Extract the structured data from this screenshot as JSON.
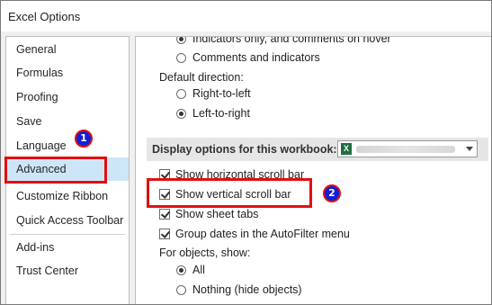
{
  "window": {
    "title": "Excel Options"
  },
  "sidebar": {
    "items": [
      {
        "label": "General"
      },
      {
        "label": "Formulas"
      },
      {
        "label": "Proofing"
      },
      {
        "label": "Save"
      },
      {
        "label": "Language"
      },
      {
        "label": "Advanced",
        "selected": true
      },
      {
        "label": "Customize Ribbon"
      },
      {
        "label": "Quick Access Toolbar"
      },
      {
        "label": "Add-ins"
      },
      {
        "label": "Trust Center"
      }
    ]
  },
  "content": {
    "comments": {
      "indicators_only": "Indicators only, and comments on hover",
      "comments_and_indicators": "Comments and indicators"
    },
    "default_direction": {
      "label": "Default direction:",
      "right_to_left": "Right-to-left",
      "left_to_right": "Left-to-right",
      "selected": "left_to_right"
    },
    "workbook_section": {
      "label": "Display options for this workbook:",
      "workbook_icon": "excel-file-icon",
      "accent_color": "#1d7044"
    },
    "options": {
      "horizontal_scroll": "Show horizontal scroll bar",
      "vertical_scroll": "Show vertical scroll bar",
      "sheet_tabs": "Show sheet tabs",
      "group_dates": "Group dates in the AutoFilter menu"
    },
    "objects": {
      "label": "For objects, show:",
      "all": "All",
      "nothing": "Nothing (hide objects)",
      "selected": "all"
    }
  },
  "annotations": {
    "step1": "1",
    "step2": "2",
    "highlight_color": "#e01010",
    "badge_color": "#1020d8"
  }
}
